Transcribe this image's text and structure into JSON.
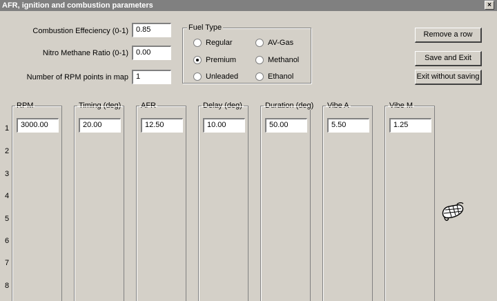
{
  "window": {
    "title": "AFR, ignition and combustion parameters",
    "close_label": "×"
  },
  "params": {
    "combustion_label": "Combustion Effeciency (0-1)",
    "combustion_value": "0.85",
    "nitro_label": "Nitro Methane Ratio (0-1)",
    "nitro_value": "0.00",
    "rpm_points_label": "Number of RPM points in map",
    "rpm_points_value": "1"
  },
  "fuel_type": {
    "title": "Fuel Type",
    "options": [
      {
        "label": "Regular",
        "checked": false
      },
      {
        "label": "Premium",
        "checked": true
      },
      {
        "label": "Unleaded",
        "checked": false
      },
      {
        "label": "AV-Gas",
        "checked": false
      },
      {
        "label": "Methanol",
        "checked": false
      },
      {
        "label": "Ethanol",
        "checked": false
      }
    ]
  },
  "buttons": {
    "remove_row": "Remove a row",
    "save_exit": "Save and Exit",
    "exit_no_save": "Exit without saving"
  },
  "columns": [
    {
      "title": "RPM",
      "value": "3000.00"
    },
    {
      "title": "Timing (deg)",
      "value": "20.00"
    },
    {
      "title": "AFR",
      "value": "12.50"
    },
    {
      "title": "Delay (deg)",
      "value": "10.00"
    },
    {
      "title": "Duration (deg)",
      "value": "50.00"
    },
    {
      "title": "Vibe A",
      "value": "5.50"
    },
    {
      "title": "Vibe M",
      "value": "1.25"
    }
  ],
  "rows": [
    "1",
    "2",
    "3",
    "4",
    "5",
    "6",
    "7",
    "8"
  ],
  "icons": {
    "cursor": "mouse-icon"
  }
}
